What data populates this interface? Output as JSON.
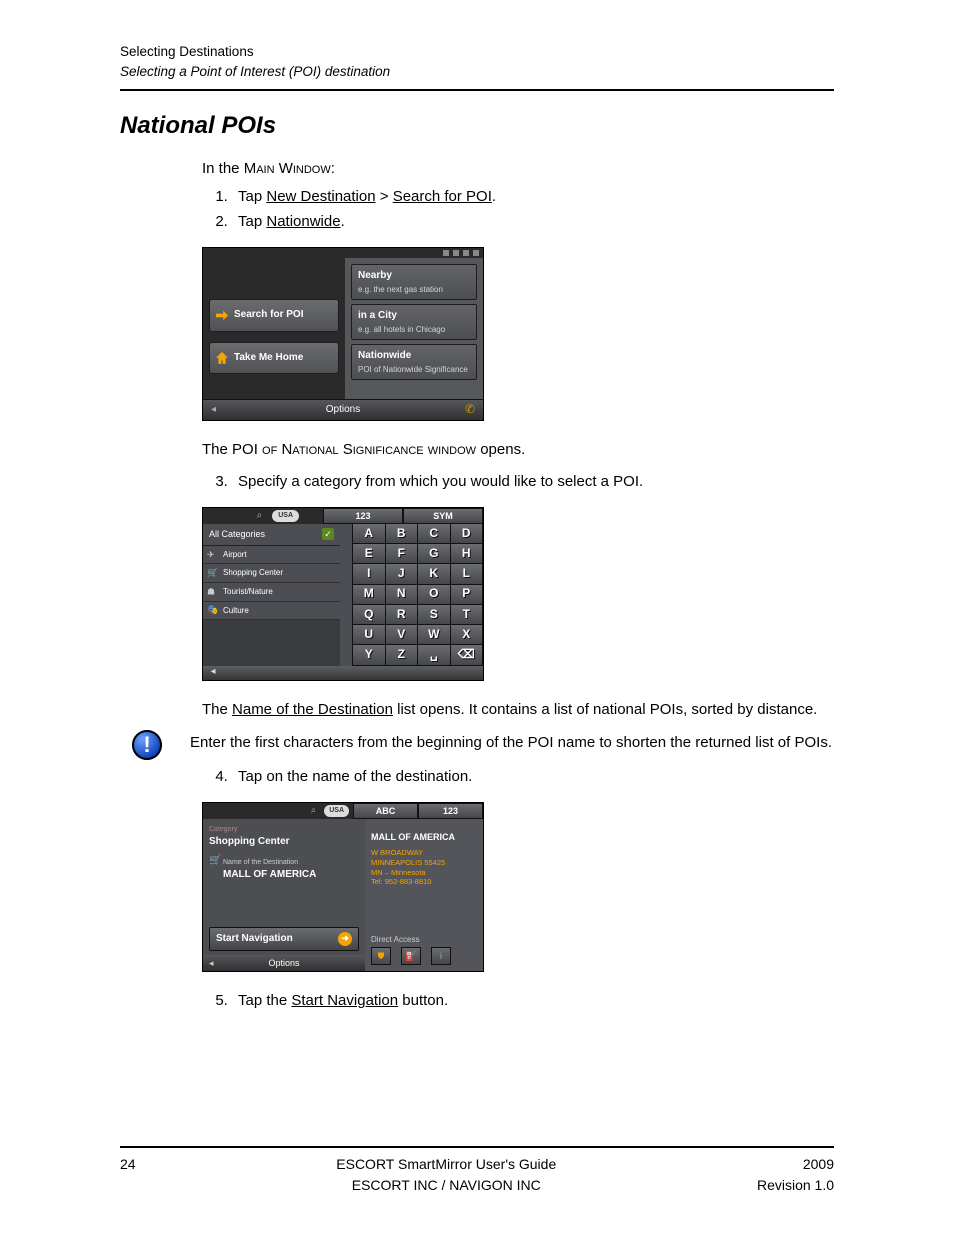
{
  "header": {
    "line1": "Selecting Destinations",
    "line2": "Selecting a Point of Interest (POI) destination"
  },
  "section_title": "National POIs",
  "intro_text": "In the ",
  "intro_caps": "Main Window:",
  "steps": {
    "s1_pre": "Tap ",
    "s1_link1": "New Destination",
    "s1_mid": " > ",
    "s1_link2": "Search for POI",
    "s1_post": ".",
    "s2_pre": "Tap ",
    "s2_link": "Nationwide",
    "s2_post": ".",
    "s3": "Specify a category from which you would like to select a POI.",
    "s4": "Tap on the name of the destination.",
    "s5_pre": "Tap the ",
    "s5_link": "Start Navigation",
    "s5_post": " button."
  },
  "after_s2_pre": "The ",
  "after_s2_caps": "POI of National Significance window",
  "after_s2_post": " opens.",
  "after_s3_pre": "The ",
  "after_s3_link": "Name of the Destination",
  "after_s3_post": " list opens. It contains a list of national POIs, sorted by distance.",
  "note_text": "Enter the first characters from the beginning of the POI name to shorten the returned list of POIs.",
  "screen1": {
    "left": {
      "search": "Search for POI",
      "home": "Take Me Home"
    },
    "right": {
      "r1t": "Nearby",
      "r1d": "e.g. the next gas station",
      "r2t": "in a City",
      "r2d": "e.g. all hotels in Chicago",
      "r3t": "Nationwide",
      "r3d": "POI of Nationwide Significance"
    },
    "options": "Options"
  },
  "screen2": {
    "usa": "USA",
    "tab1": "123",
    "tab2": "SYM",
    "allcat": "All Categories",
    "items": [
      "Airport",
      "Shopping Center",
      "Tourist/Nature",
      "Culture"
    ],
    "keys": [
      "A",
      "B",
      "C",
      "D",
      "E",
      "F",
      "G",
      "H",
      "I",
      "J",
      "K",
      "L",
      "M",
      "N",
      "O",
      "P",
      "Q",
      "R",
      "S",
      "T",
      "U",
      "V",
      "W",
      "X",
      "Y",
      "Z",
      "␣",
      "⌫"
    ]
  },
  "screen3": {
    "usa": "USA",
    "tab1": "ABC",
    "tab2": "123",
    "catlbl": "Category",
    "catval": "Shopping Center",
    "namelbl": "Name of the Destination",
    "nameval": "MALL OF AMERICA",
    "startnav": "Start Navigation",
    "options": "Options",
    "rtitle": "MALL OF AMERICA",
    "addr1": "W BROADWAY",
    "addr2": "MINNEAPOLIS 55425",
    "addr3": "MN – Minnesota",
    "addr4": "Tel: 952-883-8810",
    "da": "Direct Access"
  },
  "footer": {
    "page": "24",
    "mid1": "ESCORT SmartMirror User's Guide",
    "mid2": "ESCORT INC / NAVIGON INC",
    "r1": "2009",
    "r2": "Revision 1.0"
  }
}
